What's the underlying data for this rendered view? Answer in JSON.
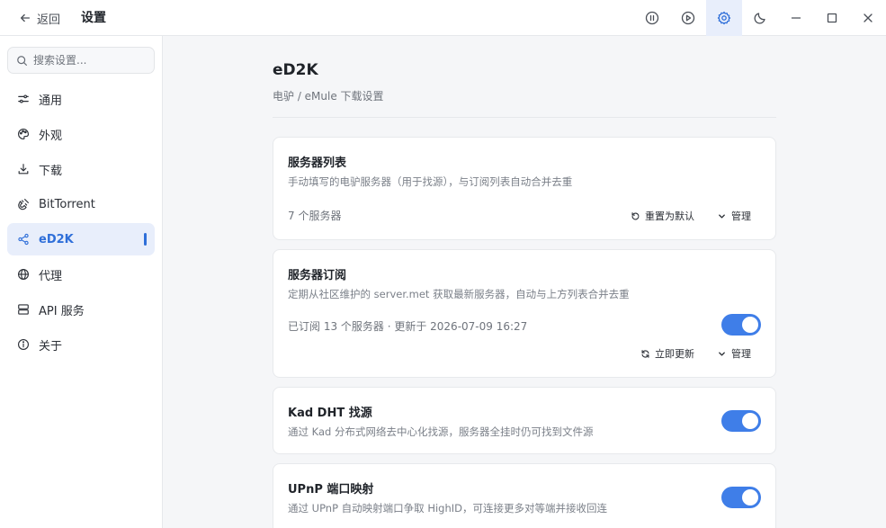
{
  "header": {
    "back_label": "返回",
    "title": "设置"
  },
  "window_controls": {
    "icons": [
      "pause-circle-icon",
      "play-circle-icon",
      "gear-icon",
      "moon-icon",
      "minimize-icon",
      "maximize-icon",
      "close-icon"
    ],
    "active": "gear-icon",
    "accent_color": "#2f6fd9"
  },
  "sidebar": {
    "search_placeholder": "搜索设置...",
    "items": [
      {
        "label": "通用",
        "icon": "sliders-icon"
      },
      {
        "label": "外观",
        "icon": "palette-icon"
      },
      {
        "label": "下载",
        "icon": "download-icon"
      },
      {
        "label": "BitTorrent",
        "icon": "magnet-icon"
      },
      {
        "label": "eD2K",
        "icon": "share-icon",
        "active": true
      },
      {
        "label": "代理",
        "icon": "globe-icon"
      },
      {
        "label": "API 服务",
        "icon": "server-icon"
      },
      {
        "label": "关于",
        "icon": "info-icon"
      }
    ]
  },
  "main": {
    "title": "eD2K",
    "subtitle": "电驴 / eMule 下载设置",
    "cards": {
      "server_list": {
        "title": "服务器列表",
        "desc": "手动填写的电驴服务器（用于找源），与订阅列表自动合并去重",
        "count": "7 个服务器",
        "reset_label": "重置为默认",
        "manage_label": "管理"
      },
      "server_subscription": {
        "title": "服务器订阅",
        "desc": "定期从社区维护的 server.met 获取最新服务器，自动与上方列表合并去重",
        "status": "已订阅 13 个服务器 · 更新于 2026-07-09 16:27",
        "enabled": true,
        "update_label": "立即更新",
        "manage_label": "管理"
      },
      "kad": {
        "title": "Kad DHT 找源",
        "desc": "通过 Kad 分布式网络去中心化找源，服务器全挂时仍可找到文件源",
        "enabled": true
      },
      "upnp": {
        "title": "UPnP 端口映射",
        "desc": "通过 UPnP 自动映射端口争取 HighID，可连接更多对等端并接收回连",
        "enabled": true
      }
    }
  }
}
